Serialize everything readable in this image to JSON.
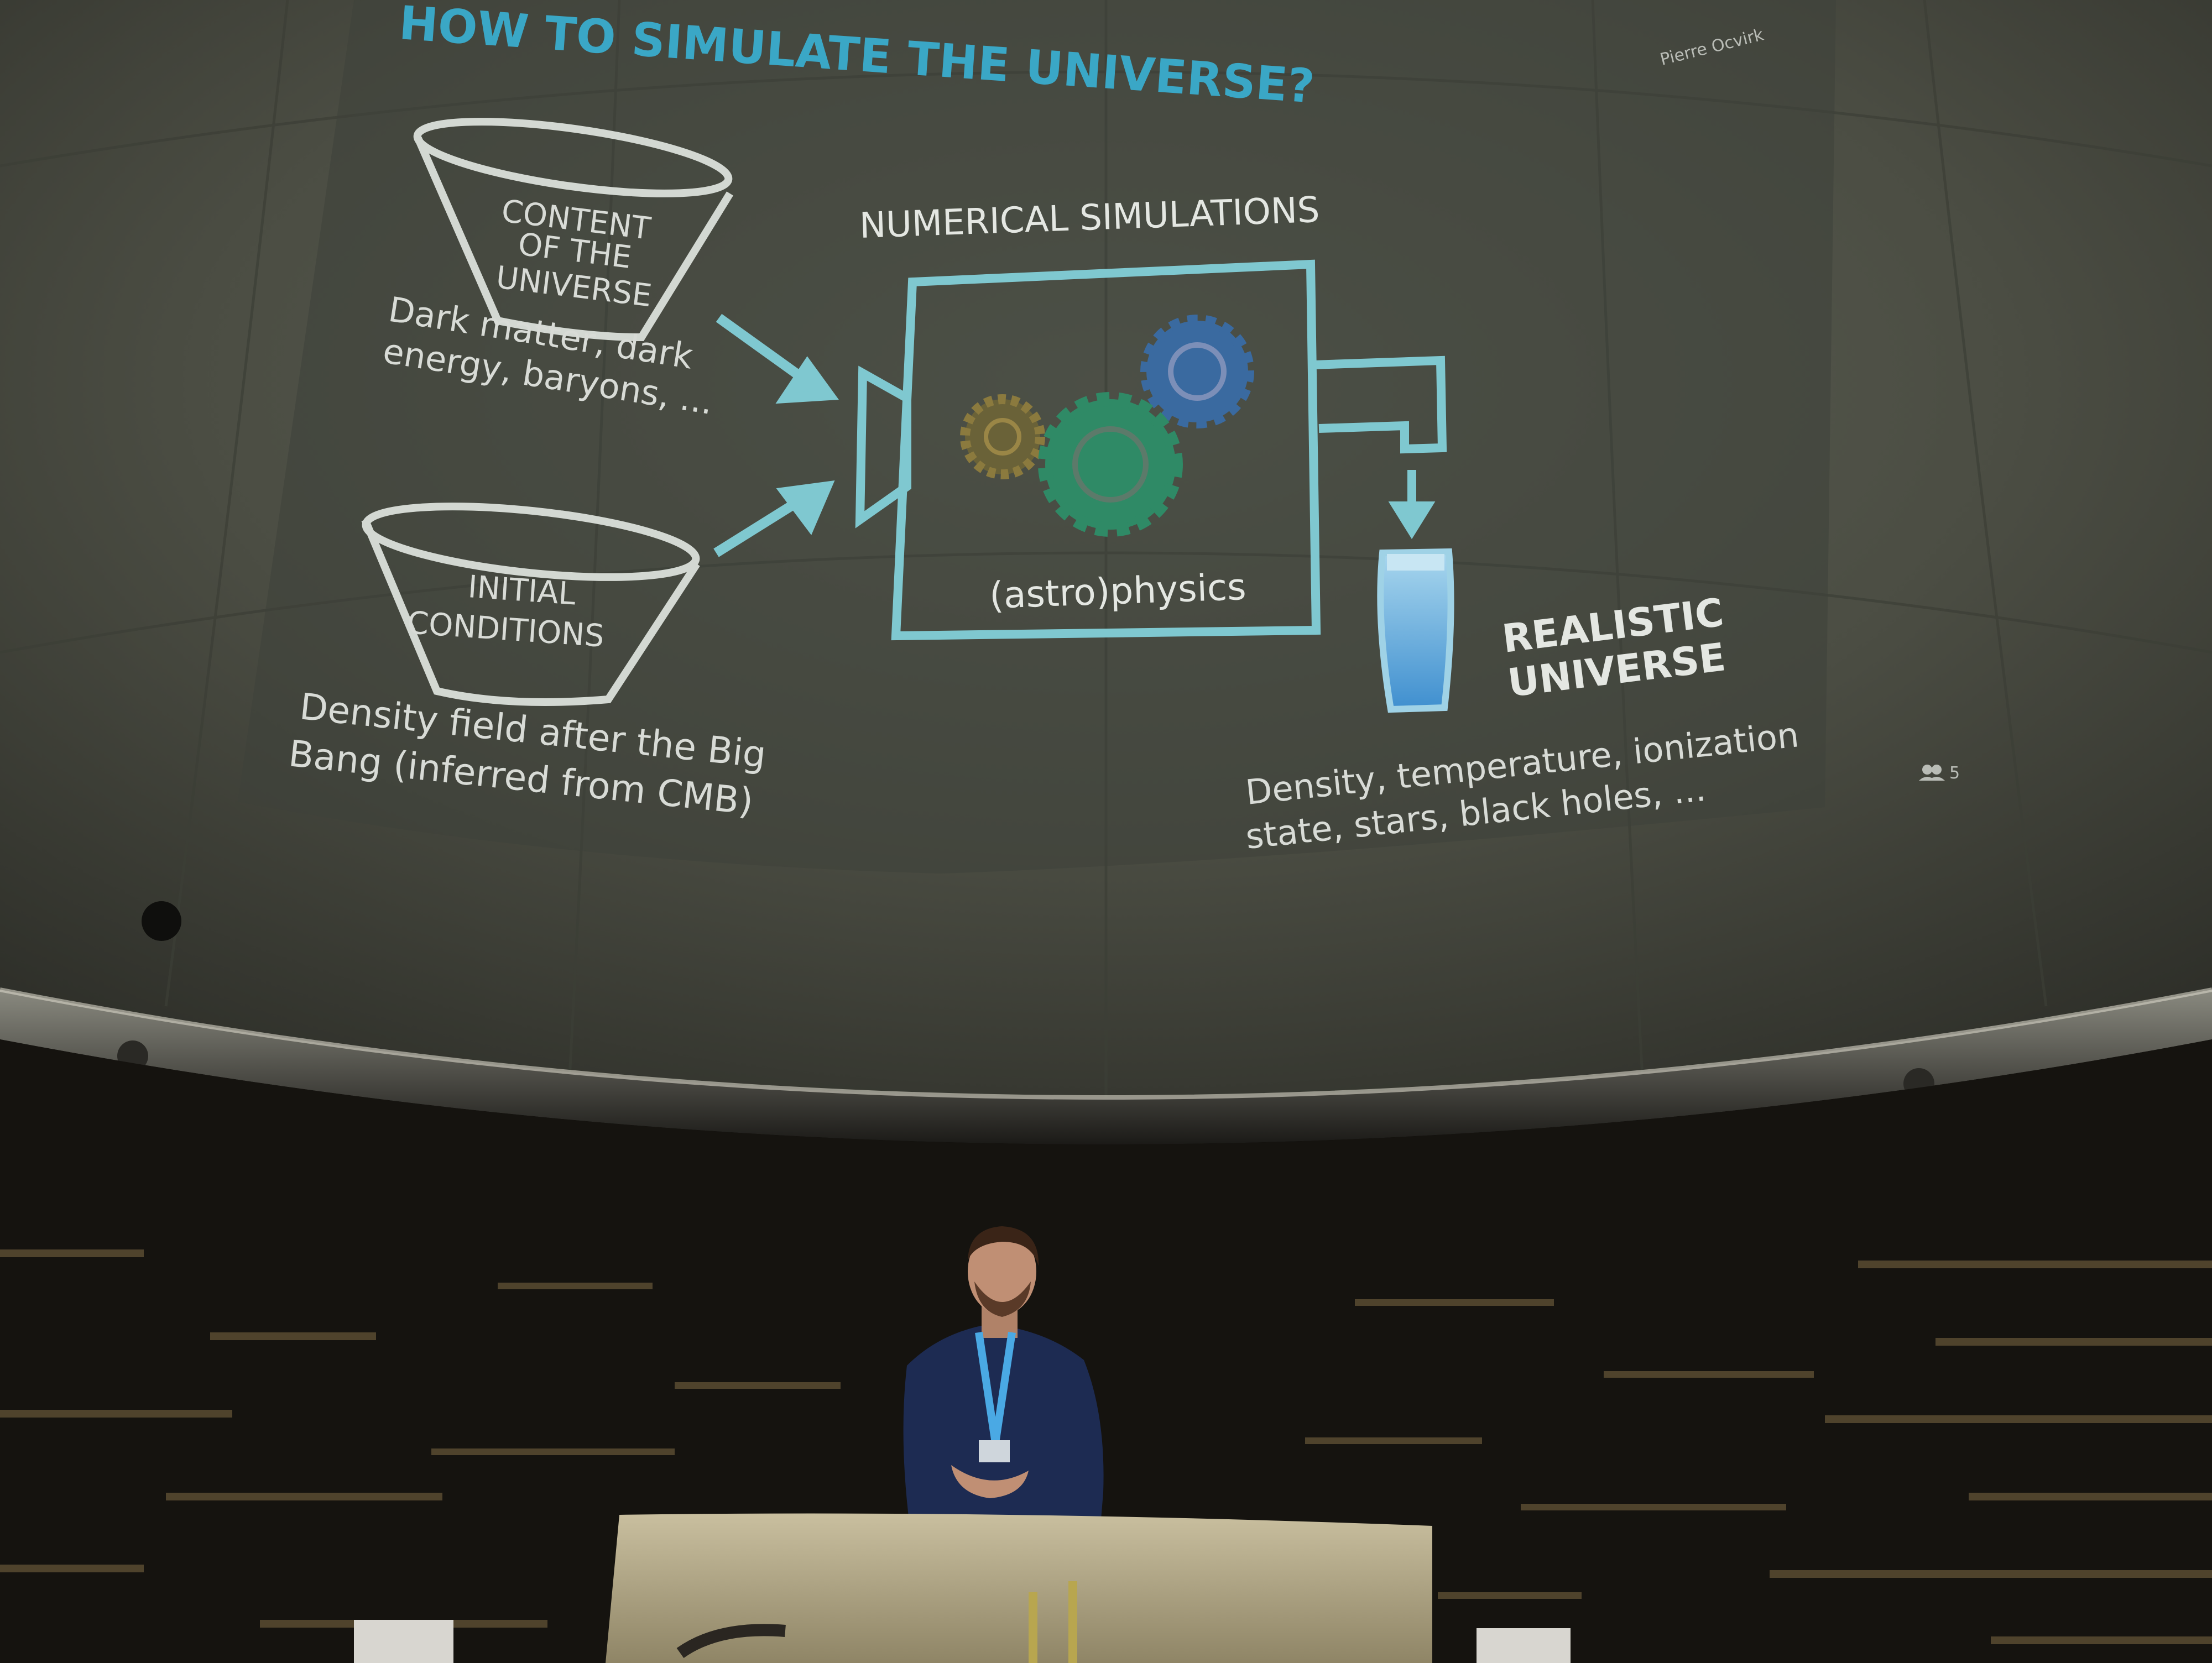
{
  "slide": {
    "title": "HOW TO SIMULATE THE UNIVERSE?",
    "author": "Pierre Ocvirk",
    "page_marker": "5",
    "section_label": "NUMERICAL SIMULATIONS",
    "funnel_top": {
      "lines": [
        "CONTENT",
        "OF THE",
        "UNIVERSE"
      ],
      "caption_lines": [
        "Dark matter, dark",
        "energy, baryons, ..."
      ]
    },
    "funnel_bottom": {
      "lines": [
        "INITIAL",
        "CONDITIONS"
      ],
      "caption_lines": [
        "Density field after the Big",
        "Bang (inferred from CMB)"
      ]
    },
    "machine_label": "(astro)physics",
    "output": {
      "label_lines": [
        "REALISTIC",
        "UNIVERSE"
      ],
      "caption_lines": [
        "Density, temperature, ionization",
        "state, stars, black holes, ..."
      ]
    }
  },
  "colors": {
    "accent": "#7fc8d0",
    "title": "#3aa7c6",
    "slide_text": "#d8dbd6",
    "gear_green": "#2f8a66",
    "gear_blue": "#3a6aa0",
    "gear_orange": "#7a6a3a",
    "glass_fill": "#5aa8d8"
  },
  "icons": [
    "funnel-icon",
    "arrow-icon",
    "gear-icon",
    "beer-glass-icon",
    "people-icon"
  ]
}
